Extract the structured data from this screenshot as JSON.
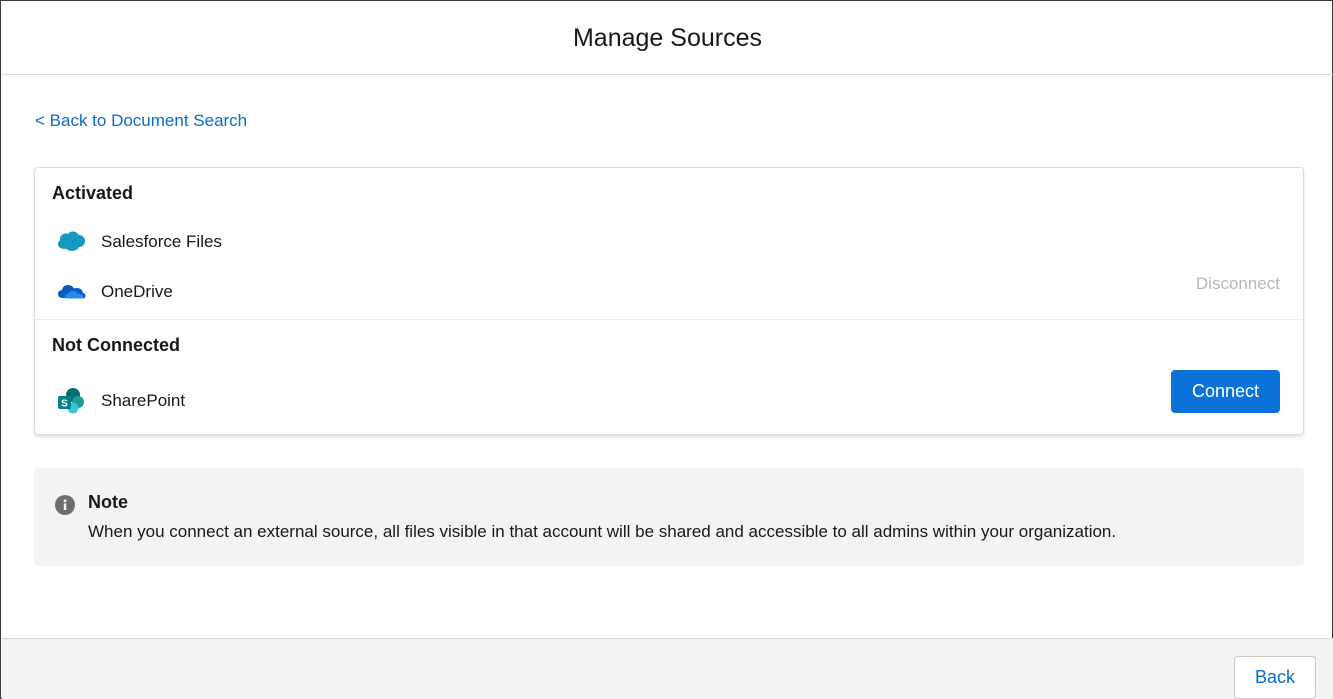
{
  "header": {
    "title": "Manage Sources"
  },
  "nav": {
    "back_link": "< Back to Document Search"
  },
  "activated": {
    "title": "Activated",
    "sources": [
      {
        "name": "Salesforce Files",
        "icon": "salesforce-cloud-icon"
      },
      {
        "name": "OneDrive",
        "icon": "onedrive-icon"
      }
    ],
    "disconnect_label": "Disconnect"
  },
  "not_connected": {
    "title": "Not Connected",
    "sources": [
      {
        "name": "SharePoint",
        "icon": "sharepoint-icon"
      }
    ],
    "connect_label": "Connect"
  },
  "note": {
    "icon": "info-icon",
    "title": "Note",
    "text": "When you connect an external source, all files visible in that account will be shared and accessible to all admins within your organization."
  },
  "footer": {
    "back_label": "Back"
  },
  "colors": {
    "link": "#0b6bcb",
    "primary_button": "#0b73d8",
    "salesforce_blue": "#1798c1",
    "onedrive_blue": "#0a5cbf",
    "sharepoint_teal": "#038387",
    "disabled_text": "#b7b7b7"
  }
}
